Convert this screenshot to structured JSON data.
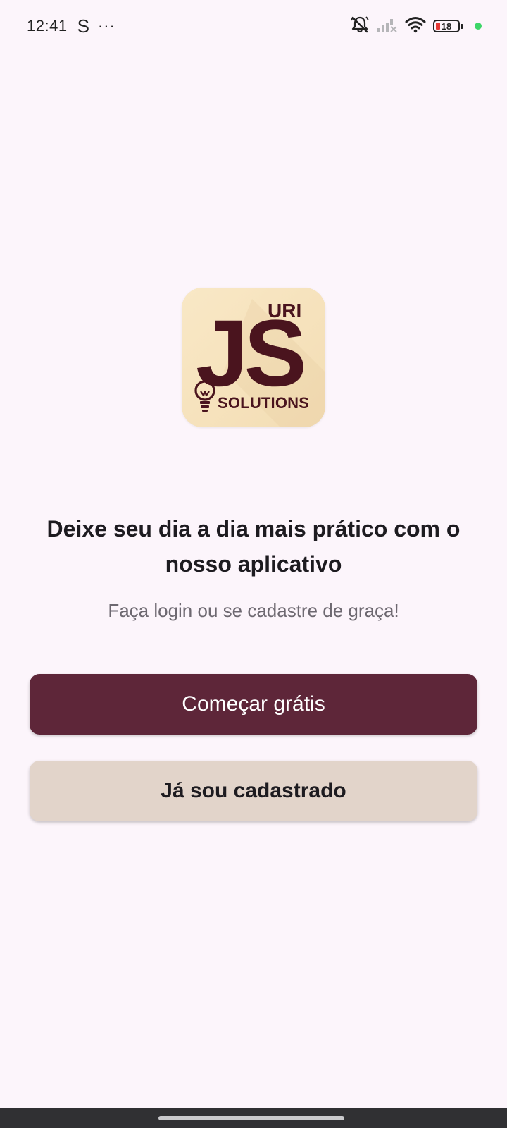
{
  "status_bar": {
    "time": "12:41",
    "app_indicator": "S",
    "more_indicator": "···",
    "battery_level": "18",
    "icons": [
      "notifications-off-icon",
      "signal-icon",
      "wifi-icon",
      "battery-icon",
      "privacy-dot-icon"
    ]
  },
  "logo": {
    "text_top": "URI",
    "text_main": "JS",
    "text_bottom": "SOLUTIONS",
    "icon": "lightbulb-icon",
    "colors": {
      "background": "#f6e3be",
      "foreground": "#4a141e"
    }
  },
  "onboarding": {
    "headline": "Deixe seu dia a dia mais prático com o nosso aplicativo",
    "subheadline": "Faça login ou se cadastre de graça!"
  },
  "actions": {
    "primary_label": "Começar grátis",
    "secondary_label": "Já sou cadastrado"
  },
  "theme": {
    "page_background": "#fcf5fb",
    "primary": "#5e2639",
    "secondary": "#e2d4ca"
  }
}
